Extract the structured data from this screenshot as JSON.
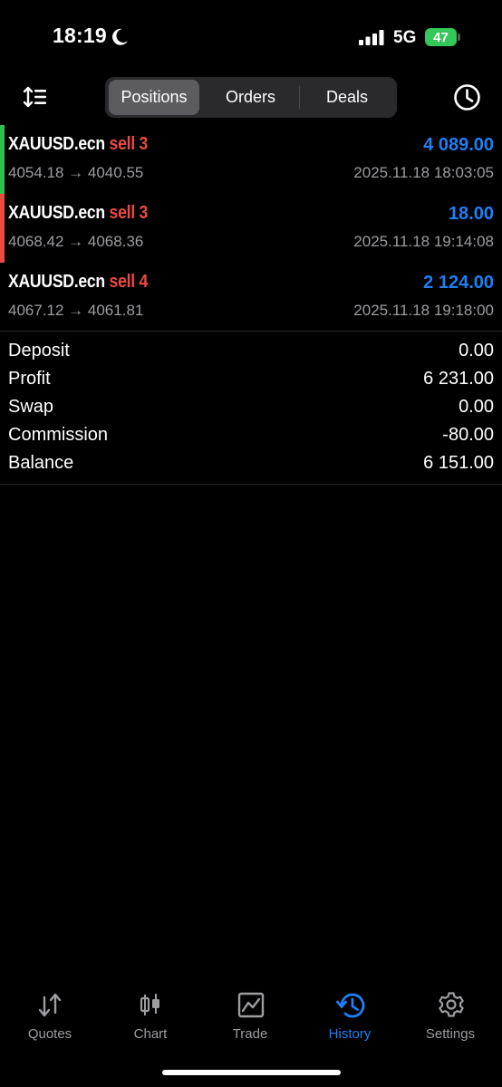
{
  "status": {
    "time": "18:19",
    "network": "5G",
    "battery": "47"
  },
  "toolbar": {
    "tabs": [
      "Positions",
      "Orders",
      "Deals"
    ],
    "active_tab": "Positions"
  },
  "positions": [
    {
      "symbol": "XAUUSD.ecn",
      "side": "sell 3",
      "price_path": "4054.18 → 4040.55",
      "profit": "4 089.00",
      "datetime": "2025.11.18 18:03:05",
      "bar_color": "#30c04f"
    },
    {
      "symbol": "XAUUSD.ecn",
      "side": "sell 3",
      "price_path": "4068.42 → 4068.36",
      "profit": "18.00",
      "datetime": "2025.11.18 19:14:08",
      "bar_color": "#ec4a44"
    },
    {
      "symbol": "XAUUSD.ecn",
      "side": "sell 4",
      "price_path": "4067.12 → 4061.81",
      "profit": "2 124.00",
      "datetime": "2025.11.18 19:18:00",
      "bar_color": ""
    }
  ],
  "summary": [
    {
      "label": "Deposit",
      "value": "0.00"
    },
    {
      "label": "Profit",
      "value": "6 231.00"
    },
    {
      "label": "Swap",
      "value": "0.00"
    },
    {
      "label": "Commission",
      "value": "-80.00"
    },
    {
      "label": "Balance",
      "value": "6 151.00"
    }
  ],
  "tabbar": {
    "items": [
      {
        "label": "Quotes",
        "icon": "quotes-icon"
      },
      {
        "label": "Chart",
        "icon": "chart-icon"
      },
      {
        "label": "Trade",
        "icon": "trade-icon"
      },
      {
        "label": "History",
        "icon": "history-icon"
      },
      {
        "label": "Settings",
        "icon": "settings-icon"
      }
    ],
    "active": "History"
  },
  "colors": {
    "accent": "#1f7ff5",
    "sell": "#ec4a44",
    "muted": "#9d9da2",
    "battery": "#34c759"
  }
}
